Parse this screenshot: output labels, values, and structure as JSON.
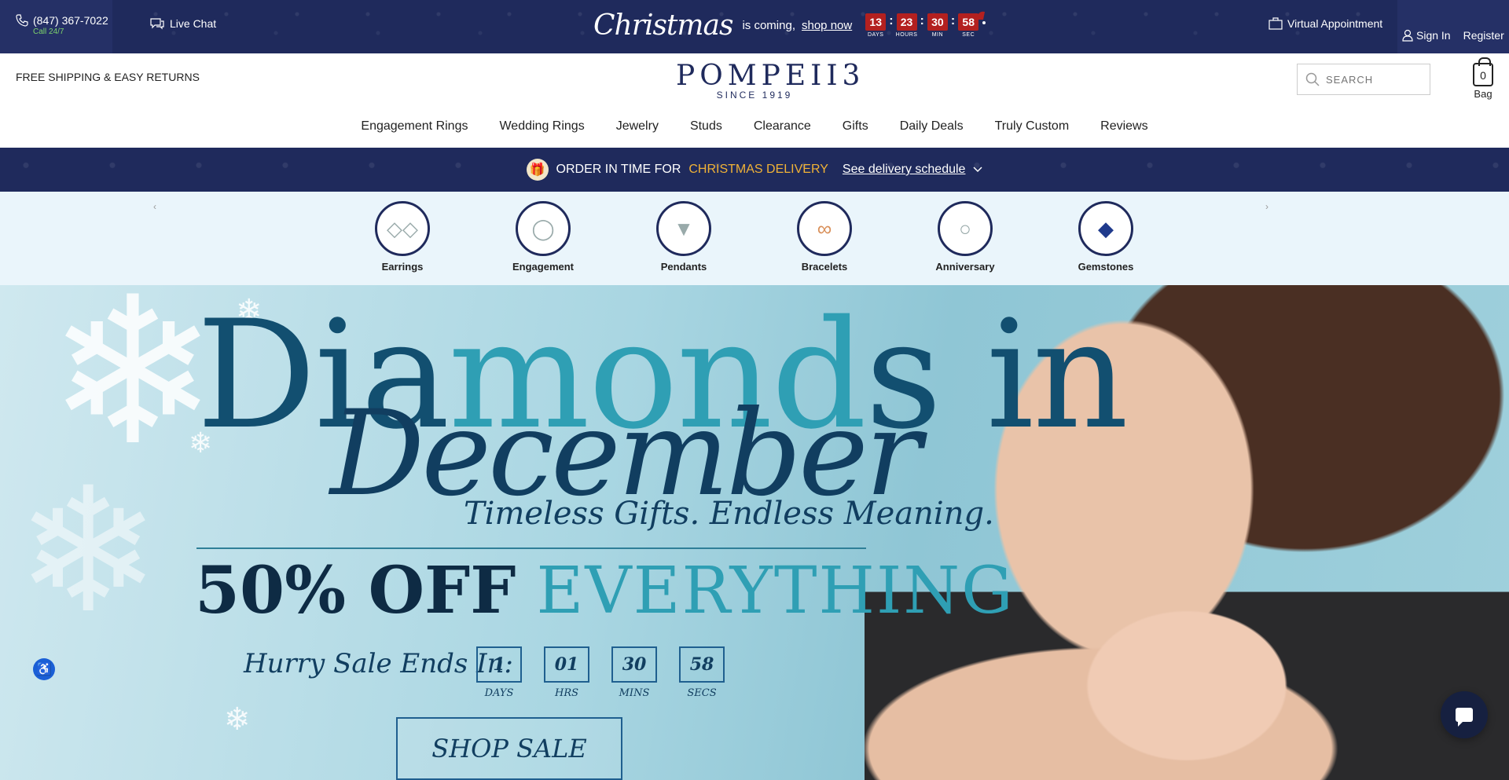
{
  "topbar": {
    "phone": "(847) 367-7022",
    "phone_sub": "Call 24/7",
    "live_chat": "Live Chat",
    "christmas": "Christmas",
    "is_coming": "is coming,",
    "shop_now": "shop now",
    "countdown": [
      {
        "value": "13",
        "label": "DAYS"
      },
      {
        "value": "23",
        "label": "HOURS"
      },
      {
        "value": "30",
        "label": "MIN"
      },
      {
        "value": "58",
        "label": "SEC"
      }
    ],
    "virtual_appointment": "Virtual Appointment",
    "sign_in": "Sign In",
    "register": "Register"
  },
  "header": {
    "free_shipping": "FREE SHIPPING & EASY RETURNS",
    "logo": "POMPEII3",
    "since": "SINCE 1919",
    "search_placeholder": "SEARCH",
    "bag_count": "0",
    "bag_label": "Bag",
    "nav": [
      "Engagement Rings",
      "Wedding Rings",
      "Jewelry",
      "Studs",
      "Clearance",
      "Gifts",
      "Daily Deals",
      "Truly Custom",
      "Reviews"
    ]
  },
  "delivery": {
    "text": "ORDER IN TIME FOR",
    "highlight": "CHRISTMAS DELIVERY",
    "link": "See delivery schedule"
  },
  "categories": [
    "Earrings",
    "Engagement",
    "Pendants",
    "Bracelets",
    "Anniversary",
    "Gemstones"
  ],
  "hero": {
    "line1a": "Dia",
    "line1b": "mond",
    "line1c": "s in",
    "line2": "December",
    "tagline": "Timeless Gifts. Endless Meaning.",
    "off": "50% OFF",
    "everything": "EVERYTHING",
    "hurry": "Hurry Sale Ends In:",
    "countdown": [
      {
        "value": "1",
        "label": "DAYS"
      },
      {
        "value": "01",
        "label": "HRS"
      },
      {
        "value": "30",
        "label": "MINS"
      },
      {
        "value": "58",
        "label": "SECS"
      }
    ],
    "cta": "SHOP SALE"
  },
  "colors": {
    "navy": "#1f2a5c",
    "accent_red": "#b3201f",
    "gold": "#f0b237",
    "teal": "#2f9fb4"
  }
}
